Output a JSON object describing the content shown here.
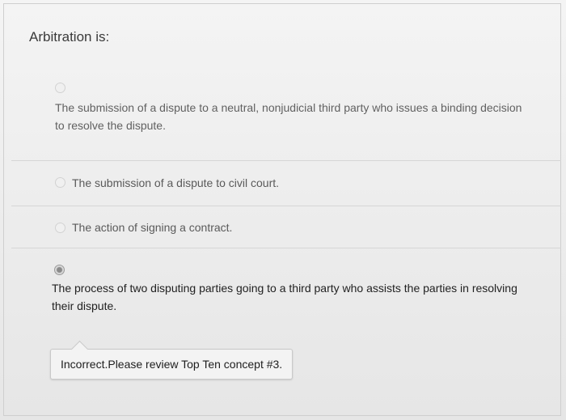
{
  "question": {
    "title": "Arbitration is:"
  },
  "answers": [
    {
      "text": "The submission of a dispute to a neutral, nonjudicial third party who issues a binding decision to resolve the dispute.",
      "selected": false
    },
    {
      "text": "The submission of a dispute to civil court.",
      "selected": false
    },
    {
      "text": "The action of signing a contract.",
      "selected": false
    },
    {
      "text": "The process of two disputing parties going to a third party who assists the parties in resolving their dispute.",
      "selected": true
    }
  ],
  "feedback": {
    "text": "Incorrect.Please review Top Ten concept #3."
  }
}
